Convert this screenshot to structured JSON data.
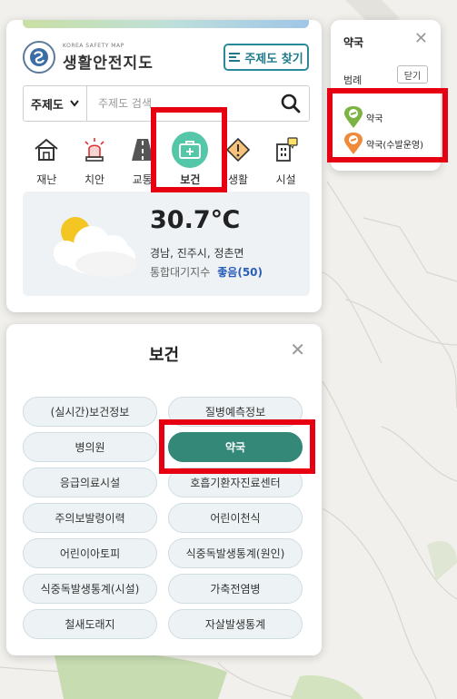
{
  "header": {
    "logo_subtitle": "KOREA SAFETY MAP",
    "logo_title": "생활안전지도",
    "theme_button": "주제도 찾기"
  },
  "search": {
    "select_value": "주제도",
    "placeholder": "주제도 검색"
  },
  "categories": [
    {
      "label": "재난",
      "icon": "house-icon"
    },
    {
      "label": "치안",
      "icon": "siren-icon"
    },
    {
      "label": "교통",
      "icon": "road-icon"
    },
    {
      "label": "보건",
      "icon": "medical-kit-icon",
      "active": true
    },
    {
      "label": "생활",
      "icon": "warning-sign-icon"
    },
    {
      "label": "시설",
      "icon": "building-icon"
    }
  ],
  "weather": {
    "temperature": "30.7℃",
    "location": "경남, 진주시, 정촌면",
    "air_label": "통합대기지수",
    "air_value": "좋음(50)"
  },
  "legend": {
    "title": "약국",
    "subtitle": "범례",
    "close_button": "닫기",
    "items": [
      {
        "label": "약국",
        "color": "#7cb342"
      },
      {
        "label": "약국(수발운영)",
        "color": "#ef8a3b"
      }
    ]
  },
  "health": {
    "title": "보건",
    "buttons": [
      "(실시간)보건정보",
      "질병예측정보",
      "병의원",
      "약국",
      "응급의료시설",
      "호흡기환자진료센터",
      "주의보발령이력",
      "어린이천식",
      "어린이아토피",
      "식중독발생통계(원인)",
      "식중독발생통계(시설)",
      "가축전염병",
      "철새도래지",
      "자살발생통계"
    ],
    "active_button": "약국"
  },
  "colors": {
    "accent": "#2a8a9a",
    "active_green": "#338878",
    "category_active": "#54c7a8",
    "highlight_red": "#e60012"
  }
}
